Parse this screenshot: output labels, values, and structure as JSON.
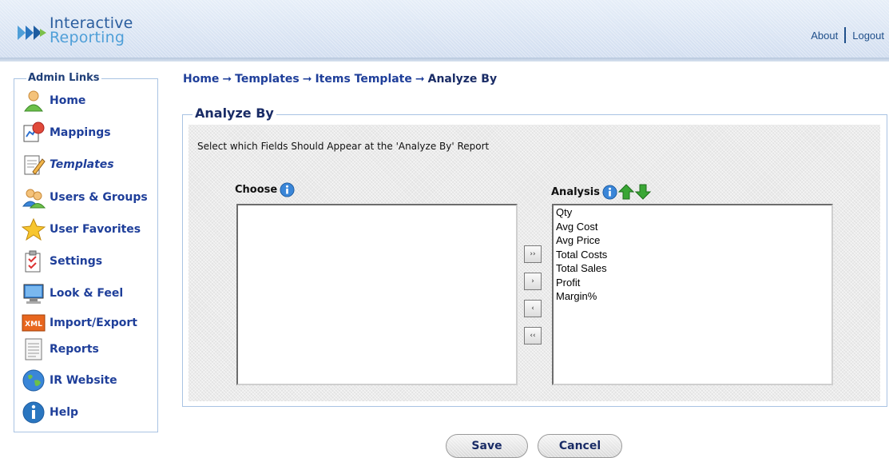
{
  "header": {
    "logo_line1": "Interactive",
    "logo_line2": "Reporting",
    "links": {
      "about": "About",
      "logout": "Logout"
    }
  },
  "sidebar": {
    "title": "Admin Links",
    "items": [
      {
        "label": "Home",
        "icon": "user-home-icon"
      },
      {
        "label": "Mappings",
        "icon": "mappings-icon"
      },
      {
        "label": "Templates",
        "icon": "templates-icon",
        "active": true
      },
      {
        "label": "Users & Groups",
        "icon": "users-groups-icon"
      },
      {
        "label": "User Favorites",
        "icon": "star-icon"
      },
      {
        "label": "Settings",
        "icon": "settings-icon"
      },
      {
        "label": "Look & Feel",
        "icon": "monitor-icon"
      },
      {
        "label": "Import/Export",
        "icon": "xml-icon"
      },
      {
        "label": "Reports",
        "icon": "reports-icon"
      },
      {
        "label": "IR Website",
        "icon": "globe-icon"
      },
      {
        "label": "Help",
        "icon": "help-icon"
      }
    ]
  },
  "breadcrumb": {
    "items": [
      "Home",
      "Templates",
      "Items Template"
    ],
    "current": "Analyze By",
    "separator": "➞"
  },
  "main": {
    "title": "Analyze By",
    "instructions": "Select which Fields Should Appear at the 'Analyze By' Report",
    "choose_label": "Choose",
    "analysis_label": "Analysis",
    "choose_options": [],
    "analysis_options": [
      "Qty",
      "Avg Cost",
      "Avg Price",
      "Total Costs",
      "Total Sales",
      "Profit",
      "Margin%"
    ],
    "move_buttons": {
      "all_right": "››",
      "right": "›",
      "left": "‹",
      "all_left": "‹‹"
    }
  },
  "actions": {
    "save": "Save",
    "cancel": "Cancel"
  },
  "colors": {
    "link": "#1f3f9a",
    "border": "#a9c3e3",
    "arrow_green": "#3aa635"
  }
}
